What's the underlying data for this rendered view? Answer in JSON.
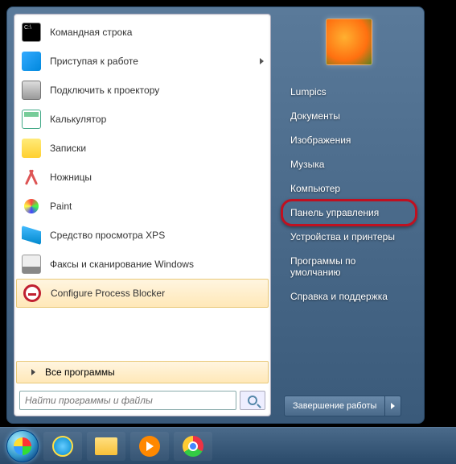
{
  "programs": [
    {
      "name": "cmd",
      "label": "Командная строка",
      "icon": "ic-cmd",
      "hasArrow": false
    },
    {
      "name": "getting-started",
      "label": "Приступая к работе",
      "icon": "ic-start",
      "hasArrow": true
    },
    {
      "name": "projector",
      "label": "Подключить к проектору",
      "icon": "ic-proj",
      "hasArrow": false
    },
    {
      "name": "calculator",
      "label": "Калькулятор",
      "icon": "ic-calc",
      "hasArrow": false
    },
    {
      "name": "sticky-notes",
      "label": "Записки",
      "icon": "ic-notes",
      "hasArrow": false
    },
    {
      "name": "snipping-tool",
      "label": "Ножницы",
      "icon": "ic-scis",
      "hasArrow": false
    },
    {
      "name": "paint",
      "label": "Paint",
      "icon": "ic-paint",
      "hasArrow": false
    },
    {
      "name": "xps-viewer",
      "label": "Средство просмотра XPS",
      "icon": "ic-xps",
      "hasArrow": false
    },
    {
      "name": "fax-scan",
      "label": "Факсы и сканирование Windows",
      "icon": "ic-fax",
      "hasArrow": false
    },
    {
      "name": "process-blocker",
      "label": "Configure Process Blocker",
      "icon": "ic-proc",
      "hasArrow": false,
      "highlighted": true
    }
  ],
  "all_programs_label": "Все программы",
  "search_placeholder": "Найти программы и файлы",
  "right_items": [
    {
      "name": "user",
      "label": "Lumpics"
    },
    {
      "name": "documents",
      "label": "Документы"
    },
    {
      "name": "pictures",
      "label": "Изображения"
    },
    {
      "name": "music",
      "label": "Музыка"
    },
    {
      "name": "computer",
      "label": "Компьютер"
    },
    {
      "name": "control-panel",
      "label": "Панель управления",
      "highlight": true
    },
    {
      "name": "devices-printers",
      "label": "Устройства и принтеры"
    },
    {
      "name": "default-programs",
      "label": "Программы по умолчанию"
    },
    {
      "name": "help",
      "label": "Справка и поддержка"
    }
  ],
  "shutdown_label": "Завершение работы",
  "taskbar_items": [
    "ie",
    "explorer",
    "wmp",
    "chrome"
  ]
}
